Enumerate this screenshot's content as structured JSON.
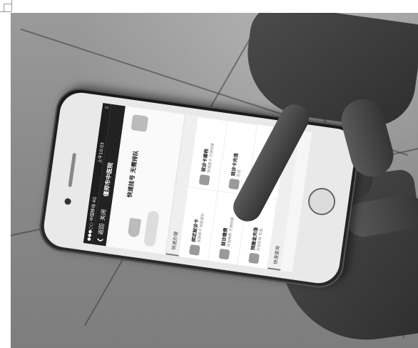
{
  "status_bar": {
    "carrier": "●●●○○ 中国移动 4G",
    "time": "上午10:03",
    "battery": "▯"
  },
  "nav_bar": {
    "back_label": "返回",
    "close_label": "关闭",
    "title": "偃师市中医院"
  },
  "banner": {
    "slogan_line1": "快速挂号 无需排队",
    "slogan_line2": ""
  },
  "sections": [
    {
      "label": "快速办理",
      "items": [
        {
          "title": "绑定就诊卡",
          "subtitle": "快速绑卡 就医便利",
          "icon": "card-bind-icon"
        },
        {
          "title": "就诊卡建档",
          "subtitle": "快速建卡 方便快捷",
          "icon": "record-icon"
        },
        {
          "title": "就诊缴费",
          "subtitle": "在线缴费 方便快捷",
          "icon": "payment-icon"
        },
        {
          "title": "就诊卡充值",
          "subtitle": "在线",
          "icon": "recharge-icon"
        },
        {
          "title": "预缴金充值",
          "subtitle": "住院在线 充值",
          "icon": "deposit-icon"
        }
      ]
    },
    {
      "label": "快速查询",
      "items": []
    }
  ],
  "colors": {
    "photo_floor": "#8a8a8a",
    "phone_body": "#1a1a1a",
    "screen_bg": "#f6f6f6"
  }
}
